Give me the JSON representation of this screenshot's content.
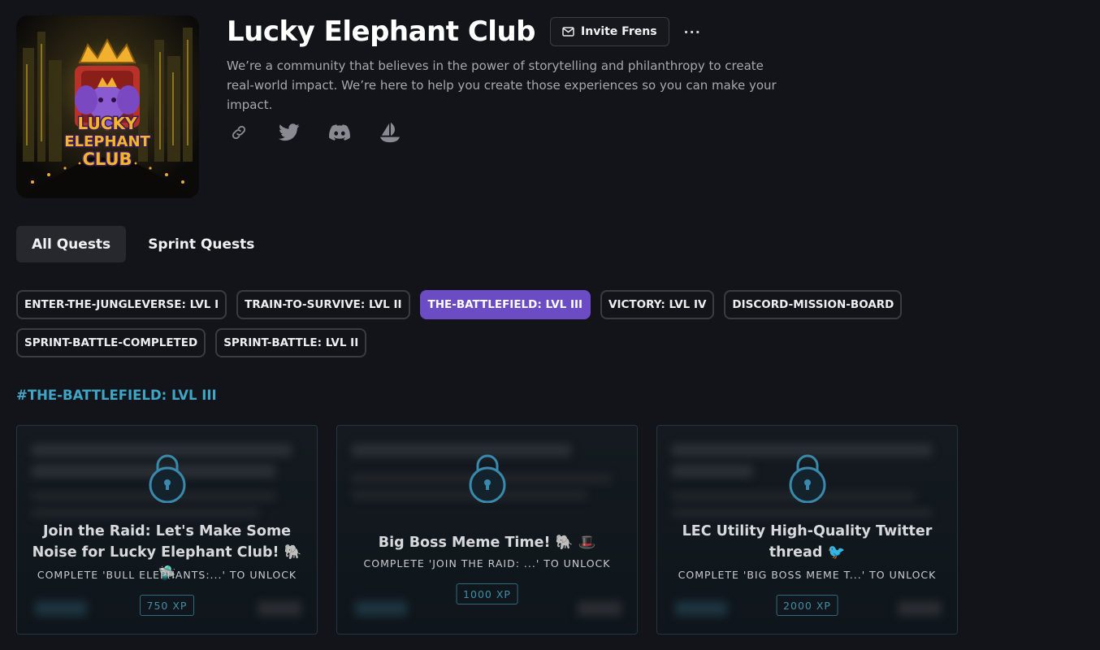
{
  "header": {
    "title": "Lucky Elephant Club",
    "invite_label": "Invite Frens",
    "more_label": "···",
    "description": "We’re a community that believes in the power of storytelling and philanthropy to create real-world impact. We’re here to help you create those experiences so you can make your impact.",
    "logo_text_1": "LUCKY",
    "logo_text_2": "ELEPHANT",
    "logo_text_3": "CLUB",
    "socials": [
      "link-icon",
      "twitter-icon",
      "discord-icon",
      "opensea-icon"
    ]
  },
  "tabs": [
    {
      "label": "All Quests",
      "active": true
    },
    {
      "label": "Sprint Quests",
      "active": false
    }
  ],
  "chips": [
    {
      "label": "ENTER-THE-JUNGLEVERSE: LVL I",
      "active": false
    },
    {
      "label": "TRAIN-TO-SURVIVE: LVL II",
      "active": false
    },
    {
      "label": "THE-BATTLEFIELD: LVL III",
      "active": true
    },
    {
      "label": "VICTORY: LVL IV",
      "active": false
    },
    {
      "label": "DISCORD-MISSION-BOARD",
      "active": false
    },
    {
      "label": "SPRINT-BATTLE-COMPLETED",
      "active": false
    },
    {
      "label": "SPRINT-BATTLE: LVL II",
      "active": false
    }
  ],
  "section_title": "#THE-BATTLEFIELD: LVL III",
  "cards": [
    {
      "title": "Join the Raid: Let's Make Some Noise for Lucky Elephant Club! 🐘 🛸",
      "unlock": "COMPLETE 'BULL ELEPHANTS:...' TO UNLOCK",
      "xp": "750 XP"
    },
    {
      "title": "Big Boss Meme Time! 🐘 🎩",
      "unlock": "COMPLETE 'JOIN THE RAID: ...' TO UNLOCK",
      "xp": "1000 XP"
    },
    {
      "title": "LEC Utility High-Quality Twitter thread 🐦",
      "unlock": "COMPLETE 'BIG BOSS MEME T...' TO UNLOCK",
      "xp": "2000 XP"
    }
  ],
  "colors": {
    "background": "#131419",
    "accent_purple": "#6b4cc4",
    "section_teal": "#3fa6c7",
    "lock_blue": "#3a88ac"
  }
}
